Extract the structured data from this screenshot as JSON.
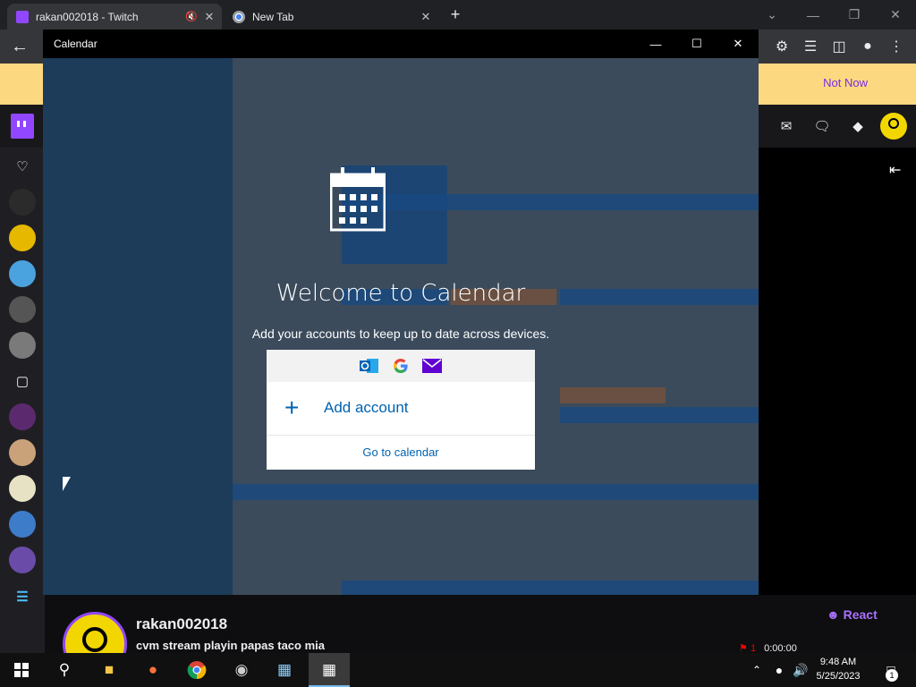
{
  "browser": {
    "tabs": [
      {
        "title": "rakan002018 - Twitch",
        "favicon": "twitch-favicon",
        "muted": true
      },
      {
        "title": "New Tab",
        "favicon": "chrome-favicon"
      }
    ],
    "new_tab_symbol": "+"
  },
  "twitch": {
    "notice": {
      "not_now_label": "Not Now"
    },
    "channel": {
      "name": "rakan002018",
      "stream_title": "cvm stream playin papas taco mia",
      "react_label": "React",
      "viewer_count": "1",
      "uptime": "0:00:00"
    }
  },
  "calendar": {
    "window_title": "Calendar",
    "welcome_heading": "Welcome to Calendar",
    "welcome_subtext": "Add your accounts to keep up to date across devices.",
    "add_account_label": "Add account",
    "add_account_symbol": "+",
    "go_to_calendar_label": "Go to calendar",
    "provider_icons": [
      "outlook-icon",
      "google-icon",
      "mail-icon"
    ]
  },
  "taskbar": {
    "time": "9:48 AM",
    "date": "5/25/2023",
    "notification_count": "1"
  },
  "colors": {
    "twitch_purple": "#9147ff",
    "notice_yellow": "#fcd980",
    "calendar_blue": "#0063b1",
    "avatar_yellow": "#f2d600"
  }
}
